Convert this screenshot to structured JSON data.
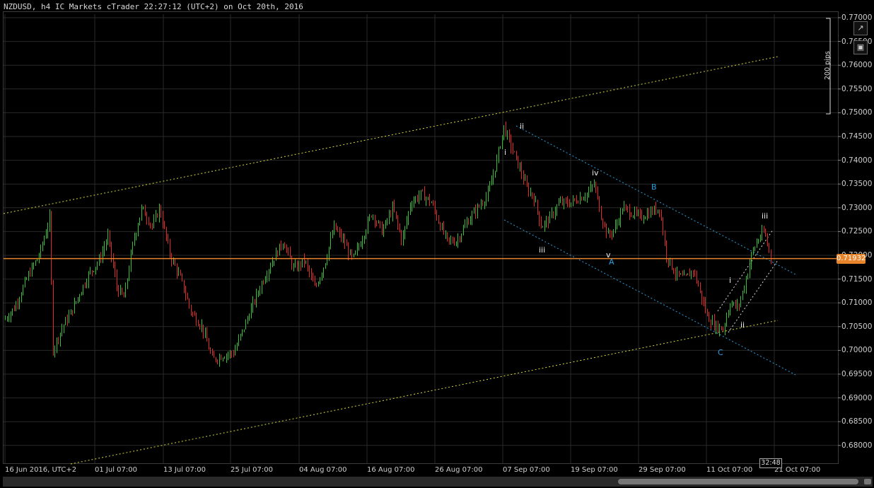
{
  "title": "NZDUSD, h4 IC Markets cTrader 22:27:12 (UTC+2) on Oct 20th, 2016",
  "current_price": "0.71932",
  "timer": "32:48",
  "pips_label": "200 pips",
  "y_ticks": [
    "0.77000",
    "0.76500",
    "0.76000",
    "0.75500",
    "0.75000",
    "0.74500",
    "0.74000",
    "0.73500",
    "0.73000",
    "0.72500",
    "0.72000",
    "0.71500",
    "0.71000",
    "0.70500",
    "0.70000",
    "0.69500",
    "0.69000",
    "0.68500",
    "0.68000"
  ],
  "x_ticks": [
    "16 Jun 2016, UTC+2",
    "01 Jul 07:00",
    "13 Jul 07:00",
    "25 Jul 07:00",
    "04 Aug 07:00",
    "16 Aug 07:00",
    "26 Aug 07:00",
    "07 Sep 07:00",
    "19 Sep 07:00",
    "29 Sep 07:00",
    "11 Oct 07:00",
    "21 Oct 07:00"
  ],
  "wave_labels": [
    {
      "text": "i",
      "color": "white"
    },
    {
      "text": "ii",
      "color": "white"
    },
    {
      "text": "iii",
      "color": "white"
    },
    {
      "text": "iv",
      "color": "white"
    },
    {
      "text": "v",
      "color": "white"
    },
    {
      "text": "A",
      "color": "blue"
    },
    {
      "text": "B",
      "color": "blue"
    },
    {
      "text": "C",
      "color": "blue"
    },
    {
      "text": "i",
      "color": "white"
    },
    {
      "text": "ii",
      "color": "white"
    },
    {
      "text": "iii",
      "color": "white"
    }
  ],
  "colors": {
    "bull": "#35c035",
    "bear": "#e02a2a",
    "channel": "#d9d93a",
    "blue_channel": "#2a9de0",
    "price_line": "#e8842c",
    "grid": "#2a2a2a"
  },
  "icons": [
    "popout-icon",
    "camera-icon"
  ],
  "chart_data": {
    "type": "candlestick",
    "symbol": "NZDUSD",
    "timeframe": "h4",
    "ylim": [
      0.678,
      0.7705
    ],
    "last_price": 0.71932
  }
}
